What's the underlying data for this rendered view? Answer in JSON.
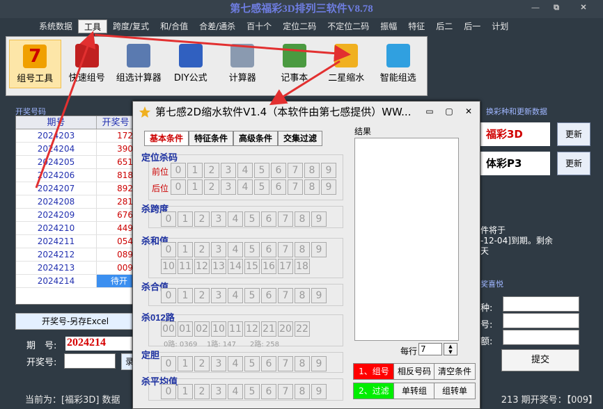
{
  "app_title": "第七感福彩3D排列三软件V8.78",
  "window_controls": {
    "minimize": "—",
    "restore": "⧉",
    "close": "✕"
  },
  "menu": [
    "系统数据",
    "工具",
    "跨度/复式",
    "和/合值",
    "合差/通杀",
    "百十个",
    "定位二码",
    "不定位二码",
    "振幅",
    "特征",
    "后二",
    "后一",
    "计划"
  ],
  "toolbar": [
    {
      "label": "组号工具",
      "icon": "seven-icon",
      "color": "#f0a000"
    },
    {
      "label": "快速组号",
      "icon": "car-icon",
      "color": "#c02020"
    },
    {
      "label": "组选计算器",
      "icon": "calculator-icon",
      "color": "#5a7ab0"
    },
    {
      "label": "DIY公式",
      "icon": "tools-icon",
      "color": "#3060c0"
    },
    {
      "label": "计算器",
      "icon": "calculator-icon",
      "color": "#8a9ab0"
    },
    {
      "label": "记事本",
      "icon": "notepad-icon",
      "color": "#4a9a40"
    },
    {
      "label": "二星缩水",
      "icon": "star-icon",
      "color": "#f0b020"
    },
    {
      "label": "智能组选",
      "icon": "thumb-icon",
      "color": "#30a0e0"
    }
  ],
  "draw_panel": {
    "title": "开奖号码",
    "headers": [
      "期号",
      "开奖号"
    ],
    "rows": [
      {
        "period": "2024203",
        "number": "172"
      },
      {
        "period": "2024204",
        "number": "390"
      },
      {
        "period": "2024205",
        "number": "651"
      },
      {
        "period": "2024206",
        "number": "818"
      },
      {
        "period": "2024207",
        "number": "892"
      },
      {
        "period": "2024208",
        "number": "281"
      },
      {
        "period": "2024209",
        "number": "676"
      },
      {
        "period": "2024210",
        "number": "449"
      },
      {
        "period": "2024211",
        "number": "054"
      },
      {
        "period": "2024212",
        "number": "089"
      },
      {
        "period": "2024213",
        "number": "009"
      },
      {
        "period": "2024214",
        "number": "待开奖"
      }
    ],
    "save_button": "开奖号-另存Excel",
    "period_label": "期　号:",
    "period_value": "2024214",
    "code_label": "开奖号:",
    "code_button": "录"
  },
  "right_panel": {
    "title": "换彩种和更新数据",
    "lotteries": [
      {
        "name": "福彩3D",
        "color": "#d00000",
        "update_label": "更新"
      },
      {
        "name": "体彩P3",
        "color": "#000000",
        "update_label": "更新"
      }
    ],
    "notice": [
      "件将于",
      "-12-04]到期。剩余",
      "天"
    ],
    "feedback_title": "奖喜悦",
    "fields": [
      "种:",
      "号:",
      "额:"
    ],
    "submit": "提交"
  },
  "status": {
    "left": "当前为：[福彩3D] 数据",
    "right": "213 期开奖号：【009】"
  },
  "dialog": {
    "title": "第七感2D缩水软件V1.4（本软件由第七感提供）WW...",
    "controls": [
      "▭",
      "▢",
      "✕"
    ],
    "tabs": [
      "基本条件",
      "特征条件",
      "高级条件",
      "交集过滤"
    ],
    "groups": {
      "position": {
        "title": "定位杀码",
        "row_labels": [
          "前位",
          "后位"
        ],
        "digits": [
          "0",
          "1",
          "2",
          "3",
          "4",
          "5",
          "6",
          "7",
          "8",
          "9"
        ]
      },
      "span": {
        "title": "杀跨度",
        "digits": [
          "0",
          "1",
          "2",
          "3",
          "4",
          "5",
          "6",
          "7",
          "8",
          "9"
        ]
      },
      "sum": {
        "title": "杀和值",
        "digits": [
          "0",
          "1",
          "2",
          "3",
          "4",
          "5",
          "6",
          "7",
          "8",
          "9",
          "10",
          "11",
          "12",
          "13",
          "14",
          "15",
          "16",
          "17",
          "18"
        ]
      },
      "hezhi": {
        "title": "杀合值",
        "digits": [
          "0",
          "1",
          "2",
          "3",
          "4",
          "5",
          "6",
          "7",
          "8",
          "9"
        ]
      },
      "road": {
        "title": "杀012路",
        "digits": [
          "00",
          "01",
          "02",
          "10",
          "11",
          "12",
          "21",
          "20",
          "22"
        ],
        "legend": [
          "0路: 0369",
          "1路: 147",
          "2路: 258"
        ]
      },
      "dan": {
        "title": "定胆",
        "digits": [
          "0",
          "1",
          "2",
          "3",
          "4",
          "5",
          "6",
          "7",
          "8",
          "9"
        ]
      },
      "avg": {
        "title": "杀平均值",
        "digits": [
          "0",
          "1",
          "2",
          "3",
          "4",
          "5",
          "6",
          "7",
          "8",
          "9"
        ]
      }
    },
    "result_label": "结果",
    "per_row_label": "每行",
    "per_row_value": "7",
    "actions": [
      "1、组号",
      "相反号码",
      "清空条件",
      "2、过滤",
      "单转组",
      "组转单"
    ]
  }
}
